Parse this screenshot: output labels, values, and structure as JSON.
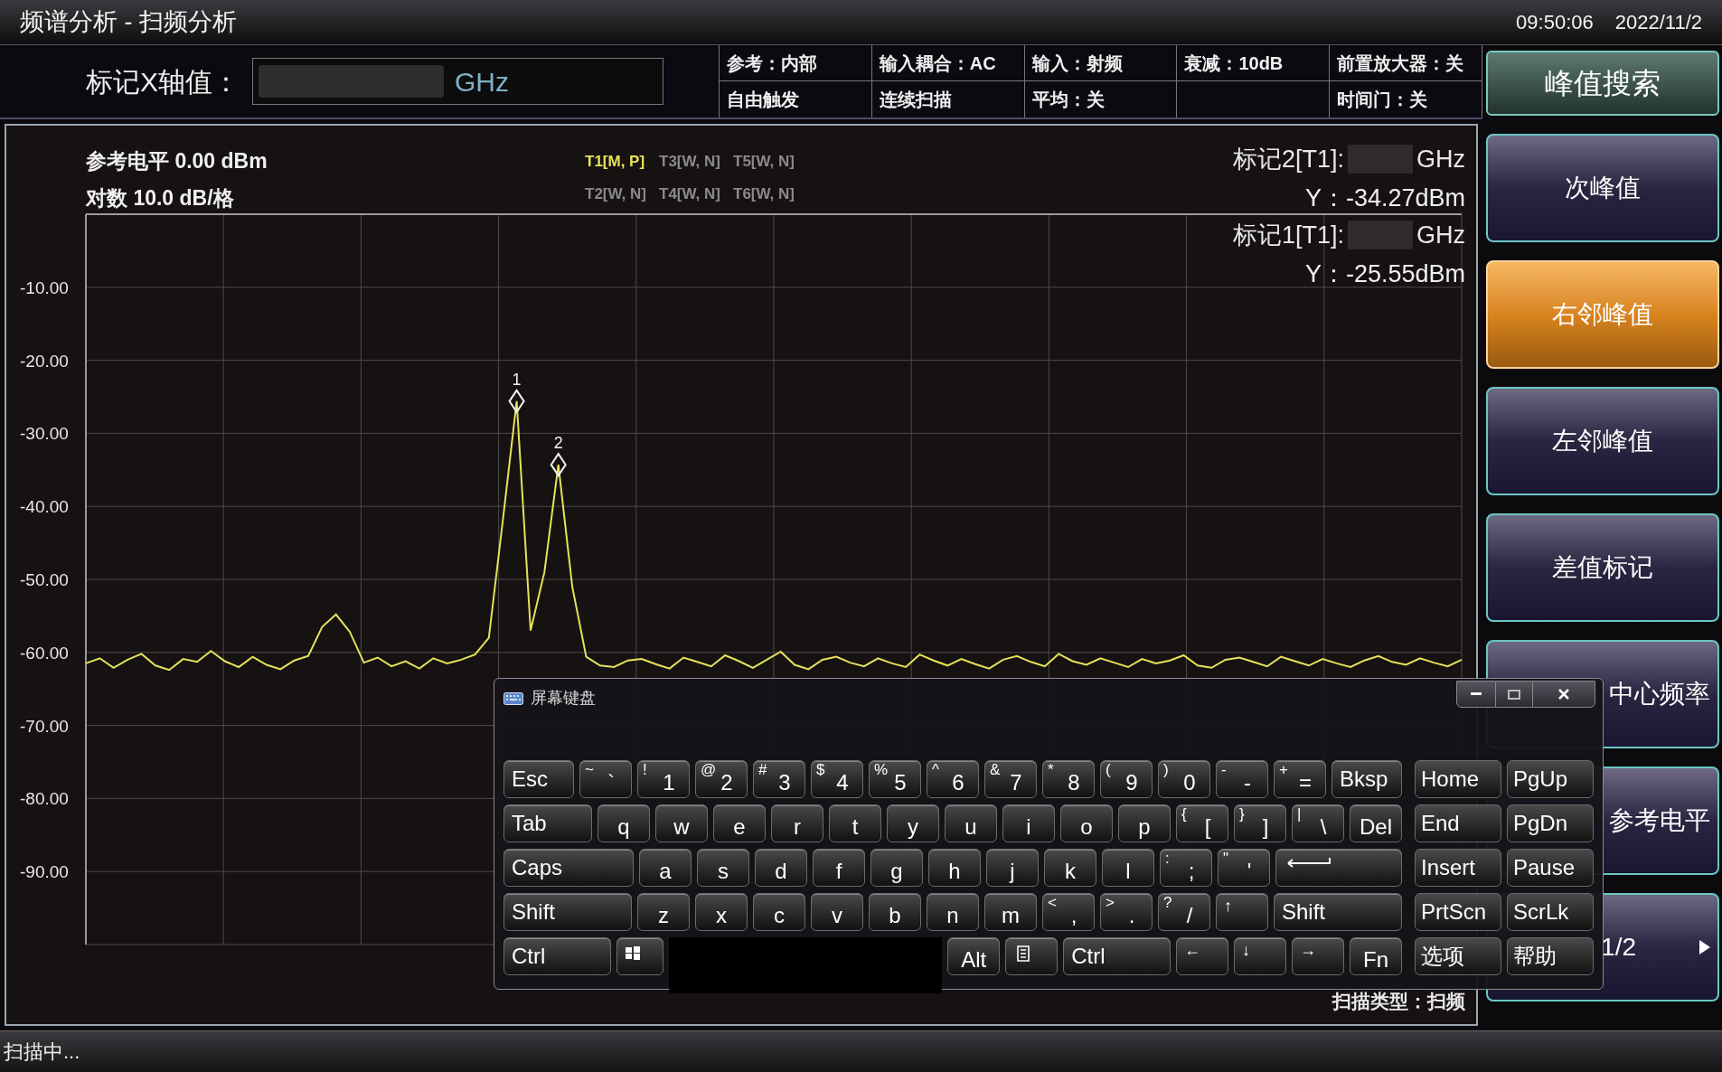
{
  "window": {
    "title": "频谱分析 - 扫频分析",
    "time": "09:50:06",
    "date": "2022/11/2"
  },
  "header": {
    "field_label": "标记X轴值：",
    "field_unit": "GHz",
    "info": [
      {
        "top": "参考：内部",
        "bottom": "自由触发"
      },
      {
        "top": "输入耦合：AC",
        "bottom": "连续扫描"
      },
      {
        "top": "输入：射频",
        "bottom": "平均：关"
      },
      {
        "top": "衰减：10dB"
      },
      {
        "top": "前置放大器：关",
        "bottom": "时间门：关"
      }
    ]
  },
  "plot": {
    "ref_level": "参考电平 0.00 dBm",
    "scale": "对数 10.0 dB/格",
    "traces": [
      {
        "label": "T1[M, P]",
        "active": true
      },
      {
        "label": "T3[W, N]",
        "active": false
      },
      {
        "label": "T5[W, N]",
        "active": false
      },
      {
        "label": "T2[W, N]",
        "active": false
      },
      {
        "label": "T4[W, N]",
        "active": false
      },
      {
        "label": "T6[W, N]",
        "active": false
      }
    ],
    "markers": [
      {
        "label": "标记2[T1]:",
        "unit": "GHz",
        "reading": "Y：-34.27dBm"
      },
      {
        "label": "标记1[T1]:",
        "unit": "GHz",
        "reading": "Y：-25.55dBm"
      }
    ],
    "sweep_type": "扫描类型：扫频",
    "peak_markers": [
      {
        "label": "1"
      },
      {
        "label": "2"
      }
    ],
    "chart_data": {
      "type": "line",
      "grid": true,
      "ylim": [
        -100,
        0
      ],
      "yticks": [
        {
          "value": -10,
          "label": "-10.00"
        },
        {
          "value": -20,
          "label": "-20.00"
        },
        {
          "value": -30,
          "label": "-30.00"
        },
        {
          "value": -40,
          "label": "-40.00"
        },
        {
          "value": -50,
          "label": "-50.00"
        },
        {
          "value": -60,
          "label": "-60.00"
        },
        {
          "value": -70,
          "label": "-70.00"
        },
        {
          "value": -80,
          "label": "-80.00"
        },
        {
          "value": -90,
          "label": "-90.00"
        }
      ],
      "series": [
        {
          "color": "#e6e25a",
          "values": [
            -61.5,
            -60.8,
            -62.1,
            -61.0,
            -60.2,
            -61.8,
            -62.4,
            -60.9,
            -61.3,
            -59.8,
            -61.2,
            -62.0,
            -60.6,
            -61.7,
            -62.3,
            -61.1,
            -60.5,
            -56.5,
            -54.8,
            -57.2,
            -61.4,
            -60.7,
            -61.9,
            -61.2,
            -62.2,
            -60.8,
            -61.5,
            -61.0,
            -60.3,
            -58.0,
            -42.0,
            -25.6,
            -57.0,
            -49.0,
            -34.3,
            -51.0,
            -60.6,
            -61.8,
            -62.0,
            -61.1,
            -60.9,
            -61.6,
            -62.2,
            -60.7,
            -61.3,
            -61.9,
            -60.4,
            -61.2,
            -62.1,
            -61.0,
            -59.9,
            -61.7,
            -62.3,
            -61.0,
            -60.6,
            -61.4,
            -61.9,
            -60.8,
            -61.5,
            -62.0,
            -60.3,
            -61.1,
            -61.8,
            -60.9,
            -61.6,
            -62.2,
            -61.0,
            -60.5,
            -61.3,
            -61.9,
            -60.2,
            -61.2,
            -61.7,
            -60.8,
            -61.4,
            -62.0,
            -60.9,
            -61.5,
            -61.1,
            -60.4,
            -61.8,
            -62.1,
            -61.0,
            -60.7,
            -61.3,
            -61.9,
            -60.6,
            -61.2,
            -61.8,
            -60.9,
            -61.5,
            -62.0,
            -61.1,
            -60.5,
            -61.3,
            -61.7,
            -60.8,
            -61.4,
            -61.9,
            -61.0
          ]
        }
      ]
    }
  },
  "sidebar": {
    "title": "峰值搜索",
    "items": [
      {
        "kind": "action",
        "label": "次峰值",
        "selected": false,
        "covered": false
      },
      {
        "kind": "action",
        "label": "右邻峰值",
        "selected": true,
        "covered": false
      },
      {
        "kind": "action",
        "label": "左邻峰值",
        "selected": false,
        "covered": false
      },
      {
        "kind": "action",
        "label": "差值标记",
        "selected": false,
        "covered": false
      },
      {
        "kind": "action",
        "label": "中心频率",
        "selected": false,
        "covered": true
      },
      {
        "kind": "action",
        "label": "参考电平",
        "selected": false,
        "covered": true
      },
      {
        "kind": "page",
        "label": "1/2",
        "selected": false,
        "covered": true
      }
    ]
  },
  "keyboard": {
    "title": "屏幕键盘",
    "rows": [
      {
        "keys": [
          {
            "kind": "wide",
            "main": "Esc"
          },
          {
            "kind": "char",
            "shift": "~",
            "main": "`"
          },
          {
            "kind": "char",
            "shift": "!",
            "main": "1"
          },
          {
            "kind": "char",
            "shift": "@",
            "main": "2"
          },
          {
            "kind": "char",
            "shift": "#",
            "main": "3"
          },
          {
            "kind": "char",
            "shift": "$",
            "main": "4"
          },
          {
            "kind": "char",
            "shift": "%",
            "main": "5"
          },
          {
            "kind": "char",
            "shift": "^",
            "main": "6"
          },
          {
            "kind": "char",
            "shift": "&",
            "main": "7"
          },
          {
            "kind": "char",
            "shift": "*",
            "main": "8"
          },
          {
            "kind": "char",
            "shift": "(",
            "main": "9"
          },
          {
            "kind": "char",
            "shift": ")",
            "main": "0"
          },
          {
            "kind": "char",
            "shift": "-",
            "main": "-"
          },
          {
            "kind": "char",
            "shift": "+",
            "main": "="
          },
          {
            "kind": "wide",
            "main": "Bksp"
          }
        ],
        "nav": [
          "Home",
          "PgUp"
        ]
      },
      {
        "keys": [
          {
            "kind": "wide",
            "main": "Tab"
          },
          {
            "kind": "char",
            "main": "q"
          },
          {
            "kind": "char",
            "main": "w"
          },
          {
            "kind": "char",
            "main": "e"
          },
          {
            "kind": "char",
            "main": "r"
          },
          {
            "kind": "char",
            "main": "t"
          },
          {
            "kind": "char",
            "main": "y"
          },
          {
            "kind": "char",
            "main": "u"
          },
          {
            "kind": "char",
            "main": "i"
          },
          {
            "kind": "char",
            "main": "o"
          },
          {
            "kind": "char",
            "main": "p"
          },
          {
            "kind": "char",
            "shift": "{",
            "main": "["
          },
          {
            "kind": "char",
            "shift": "}",
            "main": "]"
          },
          {
            "kind": "char",
            "shift": "|",
            "main": "\\"
          },
          {
            "kind": "char",
            "main": "Del"
          }
        ],
        "nav": [
          "End",
          "PgDn"
        ]
      },
      {
        "keys": [
          {
            "kind": "wide",
            "main": "Caps"
          },
          {
            "kind": "char",
            "main": "a"
          },
          {
            "kind": "char",
            "main": "s"
          },
          {
            "kind": "char",
            "main": "d"
          },
          {
            "kind": "char",
            "main": "f"
          },
          {
            "kind": "char",
            "main": "g"
          },
          {
            "kind": "char",
            "main": "h"
          },
          {
            "kind": "char",
            "main": "j"
          },
          {
            "kind": "char",
            "main": "k"
          },
          {
            "kind": "char",
            "main": "l"
          },
          {
            "kind": "char",
            "shift": ":",
            "main": ";"
          },
          {
            "kind": "char",
            "shift": "\"",
            "main": "'"
          },
          {
            "kind": "enter"
          }
        ],
        "nav": [
          "Insert",
          "Pause"
        ]
      },
      {
        "keys": [
          {
            "kind": "wide",
            "main": "Shift"
          },
          {
            "kind": "char",
            "main": "z"
          },
          {
            "kind": "char",
            "main": "x"
          },
          {
            "kind": "char",
            "main": "c"
          },
          {
            "kind": "char",
            "main": "v"
          },
          {
            "kind": "char",
            "main": "b"
          },
          {
            "kind": "char",
            "main": "n"
          },
          {
            "kind": "char",
            "main": "m"
          },
          {
            "kind": "char",
            "shift": "<",
            "main": ","
          },
          {
            "kind": "char",
            "shift": ">",
            "main": "."
          },
          {
            "kind": "char",
            "shift": "?",
            "main": "/"
          },
          {
            "kind": "arrow",
            "main": "↑"
          },
          {
            "kind": "wide",
            "main": "Shift"
          }
        ],
        "nav": [
          "PrtScn",
          "ScrLk"
        ]
      },
      {
        "keys": [
          {
            "kind": "wide",
            "main": "Ctrl"
          },
          {
            "kind": "win"
          },
          {
            "kind": "redacted"
          },
          {
            "kind": "char",
            "main": "Alt"
          },
          {
            "kind": "menu"
          },
          {
            "kind": "wide",
            "main": "Ctrl"
          },
          {
            "kind": "arrow",
            "main": "←"
          },
          {
            "kind": "arrow",
            "main": "↓"
          },
          {
            "kind": "arrow",
            "main": "→"
          },
          {
            "kind": "char",
            "main": "Fn"
          }
        ],
        "nav": [
          "选项",
          "帮助"
        ]
      }
    ]
  },
  "status_bar": {
    "text": "扫描中..."
  }
}
